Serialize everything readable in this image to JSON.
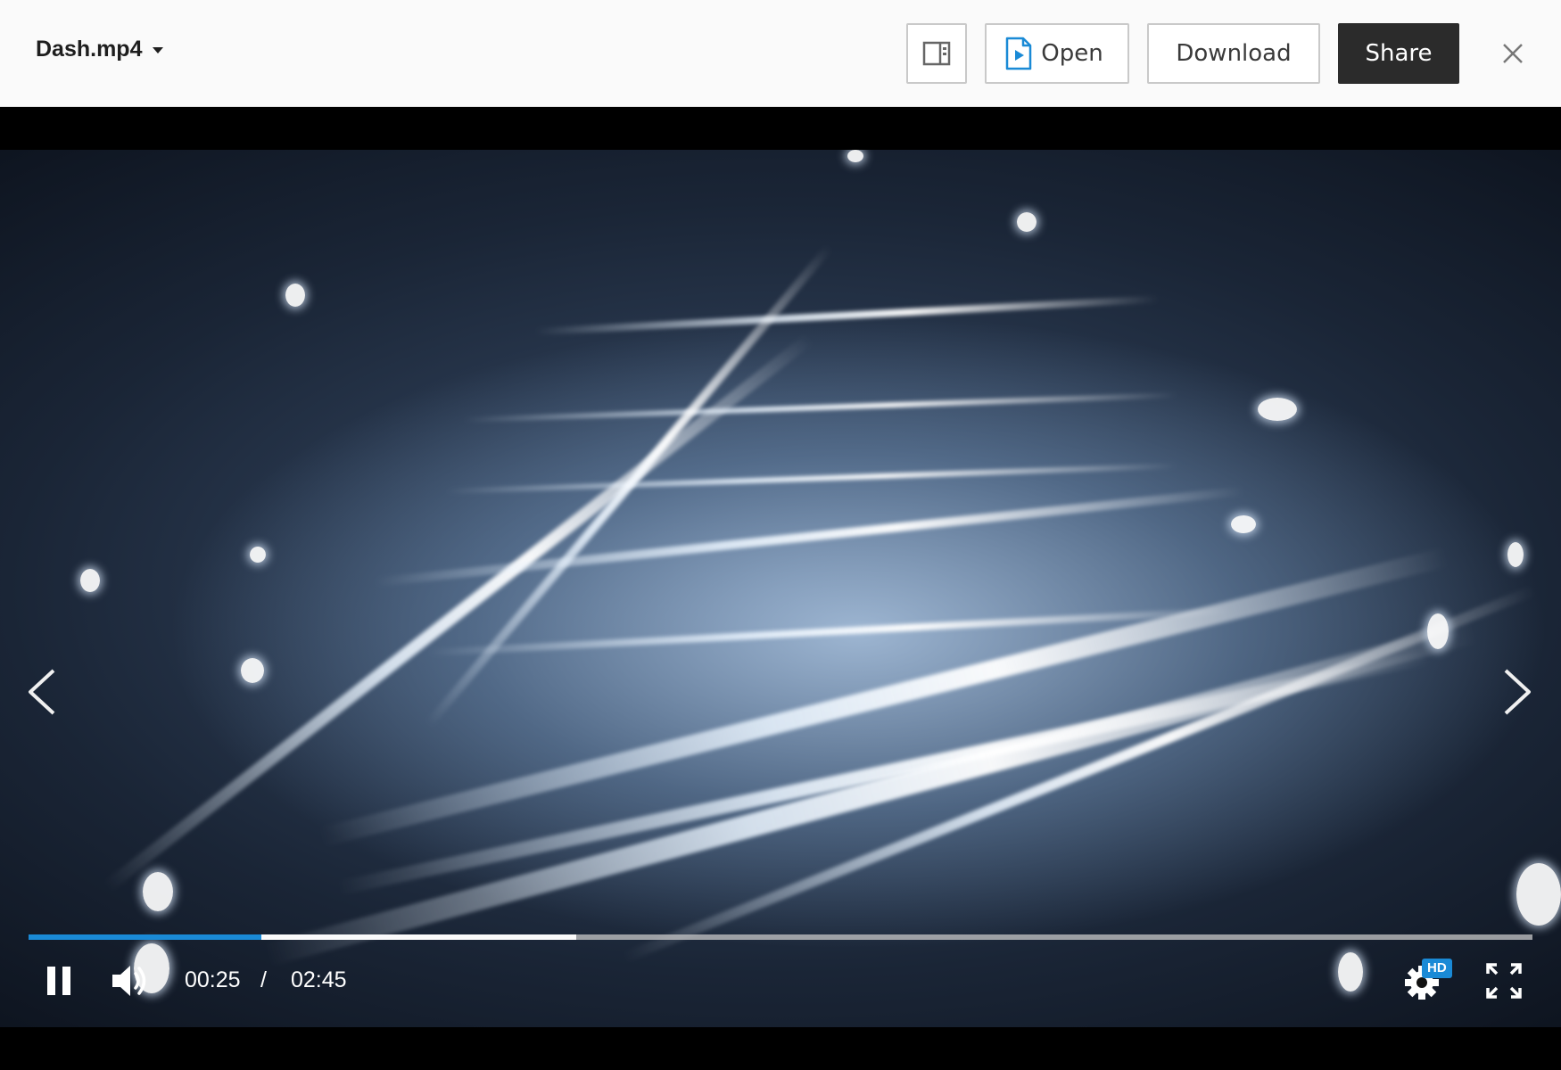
{
  "header": {
    "file_name": "Dash.mp4",
    "open_label": "Open",
    "download_label": "Download",
    "share_label": "Share"
  },
  "player": {
    "current_time": "00:25",
    "time_separator": "/",
    "total_time": "02:45",
    "played_fraction": 0.155,
    "buffered_fraction": 0.364,
    "quality_badge": "HD",
    "state": "playing"
  },
  "colors": {
    "accent": "#1a8ad6",
    "share_button_bg": "#2b2b2b",
    "header_bg": "#fafafa"
  },
  "icons": {
    "sidebar_toggle": "sidebar-panel-icon",
    "open_app": "video-file-icon",
    "close": "close-icon",
    "previous": "chevron-left-icon",
    "next": "chevron-right-icon",
    "pause": "pause-icon",
    "volume": "volume-icon",
    "settings": "gear-icon",
    "fullscreen": "fullscreen-icon"
  }
}
